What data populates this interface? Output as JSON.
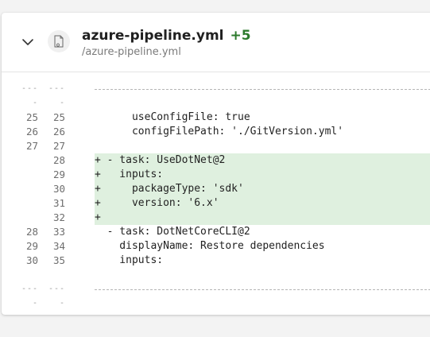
{
  "file": {
    "name": "azure-pipeline.yml",
    "added_count": "+5",
    "path": "/azure-pipeline.yml"
  },
  "diff": {
    "separator_marker": "----",
    "rows": [
      {
        "type": "sep",
        "old": "----",
        "new": "----",
        "code": ""
      },
      {
        "type": "blank",
        "old": "",
        "new": "",
        "code": ""
      },
      {
        "type": "context",
        "old": "25",
        "new": "25",
        "code": "      useConfigFile: true"
      },
      {
        "type": "context",
        "old": "26",
        "new": "26",
        "code": "      configFilePath: './GitVersion.yml'"
      },
      {
        "type": "context",
        "old": "27",
        "new": "27",
        "code": ""
      },
      {
        "type": "added",
        "old": "",
        "new": "28",
        "code": "+ - task: UseDotNet@2"
      },
      {
        "type": "added",
        "old": "",
        "new": "29",
        "code": "+   inputs:"
      },
      {
        "type": "added",
        "old": "",
        "new": "30",
        "code": "+     packageType: 'sdk'"
      },
      {
        "type": "added",
        "old": "",
        "new": "31",
        "code": "+     version: '6.x'"
      },
      {
        "type": "added",
        "old": "",
        "new": "32",
        "code": "+"
      },
      {
        "type": "context",
        "old": "28",
        "new": "33",
        "code": "  - task: DotNetCoreCLI@2"
      },
      {
        "type": "context",
        "old": "29",
        "new": "34",
        "code": "    displayName: Restore dependencies"
      },
      {
        "type": "context",
        "old": "30",
        "new": "35",
        "code": "    inputs:"
      },
      {
        "type": "blank",
        "old": "",
        "new": "",
        "code": ""
      },
      {
        "type": "sep",
        "old": "----",
        "new": "----",
        "code": ""
      }
    ]
  },
  "colors": {
    "added_bg": "#dff0df",
    "added_count": "#2c7a2c"
  },
  "icons": {
    "collapse": "chevron-down-icon",
    "file": "file-icon"
  }
}
